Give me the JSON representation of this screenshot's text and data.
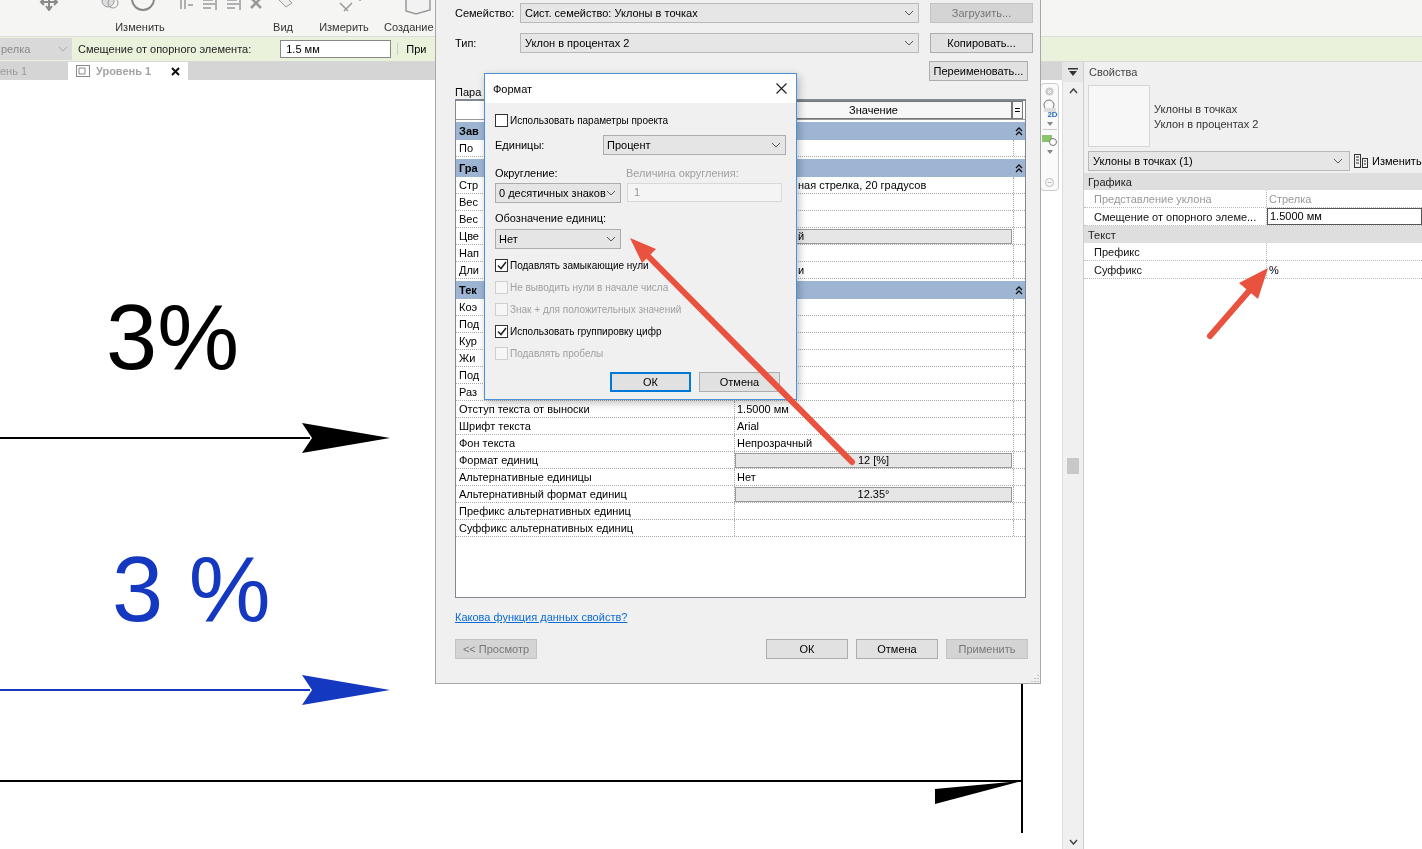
{
  "ribbon": {
    "panels": [
      "Изменить",
      "Вид",
      "Измерить",
      "Создание"
    ]
  },
  "options_bar": {
    "type_dropdown": "релка",
    "offset_label": "Смещение от опорного элемента:",
    "offset_value": "1.5 мм",
    "next_label": "При"
  },
  "view_tabs": [
    {
      "label": "ень 1",
      "selected": false
    },
    {
      "label": "Уровень 1",
      "selected": true
    }
  ],
  "canvas": {
    "spot_slopes": [
      {
        "label": "3%",
        "color": "#000000"
      },
      {
        "label": "3 %",
        "color": "#1438c0"
      }
    ]
  },
  "navigation_bar": {
    "mode": "2D"
  },
  "type_dialog": {
    "family_label": "Семейство:",
    "family": "Сист. семейство: Уклоны в точках",
    "type_label": "Тип:",
    "type": "Уклон в процентах 2",
    "side_buttons": [
      {
        "label": "Загрузить...",
        "disabled": true
      },
      {
        "label": "Копировать...",
        "disabled": false
      },
      {
        "label": "Переименовать...",
        "disabled": false
      }
    ],
    "params_label": "Пара",
    "table": {
      "columns": [
        "Значение",
        "="
      ],
      "rows": [
        {
          "kind": "group",
          "name": "Зав"
        },
        {
          "kind": "param",
          "name": "По"
        },
        {
          "kind": "group",
          "name": "Гра"
        },
        {
          "kind": "param",
          "name": "Стр",
          "value": "ная стрелка, 20 градусов"
        },
        {
          "kind": "param",
          "name": "Вес"
        },
        {
          "kind": "param",
          "name": "Вес"
        },
        {
          "kind": "button",
          "name": "Цве",
          "value": "й"
        },
        {
          "kind": "param",
          "name": "Нап"
        },
        {
          "kind": "param",
          "name": "Дли",
          "value": "и"
        },
        {
          "kind": "group",
          "name": "Тек"
        },
        {
          "kind": "param",
          "name": "Коэ"
        },
        {
          "kind": "param",
          "name": "Под"
        },
        {
          "kind": "param",
          "name": "Кур"
        },
        {
          "kind": "param",
          "name": "Жи"
        },
        {
          "kind": "param",
          "name": "Под"
        },
        {
          "kind": "param",
          "name": "Раз"
        },
        {
          "kind": "param",
          "name": "Отступ текста от выноски",
          "value": "1.5000 мм"
        },
        {
          "kind": "param",
          "name": "Шрифт текста",
          "value": "Arial"
        },
        {
          "kind": "param",
          "name": "Фон текста",
          "value": "Непрозрачный"
        },
        {
          "kind": "button",
          "name": "Формат единиц",
          "value": "12 [%]"
        },
        {
          "kind": "param",
          "name": "Альтернативные единицы",
          "value": "Нет"
        },
        {
          "kind": "button",
          "name": "Альтернативный формат единиц",
          "value": "12.35°"
        },
        {
          "kind": "param",
          "name": "Префикс альтернативных единиц"
        },
        {
          "kind": "param",
          "name": "Суффикс альтернативных единиц"
        }
      ]
    },
    "help_link": "Какова функция данных свойств?",
    "preview_button": {
      "label": "<< Просмотр",
      "disabled": true
    },
    "buttons": [
      {
        "label": "ОК",
        "disabled": false
      },
      {
        "label": "Отмена",
        "disabled": false
      },
      {
        "label": "Применить",
        "disabled": true
      }
    ]
  },
  "format_dialog": {
    "title": "Формат",
    "use_project": {
      "label": "Использовать параметры проекта",
      "checked": false,
      "disabled": false
    },
    "units_label": "Единицы:",
    "units": "Процент",
    "rounding_label": "Округление:",
    "rounding": "0 десятичных знаков",
    "increment_label": "Величина округления:",
    "increment": "1",
    "symbol_label": "Обозначение единиц:",
    "symbol": "Нет",
    "options": [
      {
        "label": "Подавлять замыкающие нули",
        "checked": true,
        "disabled": false
      },
      {
        "label": "Не выводить нули в начале числа",
        "checked": false,
        "disabled": true
      },
      {
        "label": "Знак + для положительных значений",
        "checked": false,
        "disabled": true
      },
      {
        "label": "Использовать группировку цифр",
        "checked": true,
        "disabled": false
      },
      {
        "label": "Подавлять пробелы",
        "checked": false,
        "disabled": true
      }
    ],
    "buttons": [
      {
        "label": "ОК",
        "focused": true
      },
      {
        "label": "Отмена",
        "focused": false
      }
    ]
  },
  "properties": {
    "title": "Свойства",
    "family": "Уклоны в точках",
    "type": "Уклон в процентах 2",
    "selector": "Уклоны в точках (1)",
    "edit_button": "Изменить",
    "groups": [
      {
        "name": "Графика",
        "rows": [
          {
            "name": "Представление уклона",
            "value": "Стрелка",
            "disabled": true,
            "kind": "text"
          },
          {
            "name": "Смещение от опорного элеме...",
            "value": "1.5000 мм",
            "disabled": false,
            "kind": "input"
          }
        ]
      },
      {
        "name": "Текст",
        "rows": [
          {
            "name": "Префикс",
            "disabled": false,
            "kind": "text"
          },
          {
            "name": "Суффикс",
            "value": "%",
            "disabled": false,
            "kind": "text"
          }
        ]
      }
    ]
  }
}
